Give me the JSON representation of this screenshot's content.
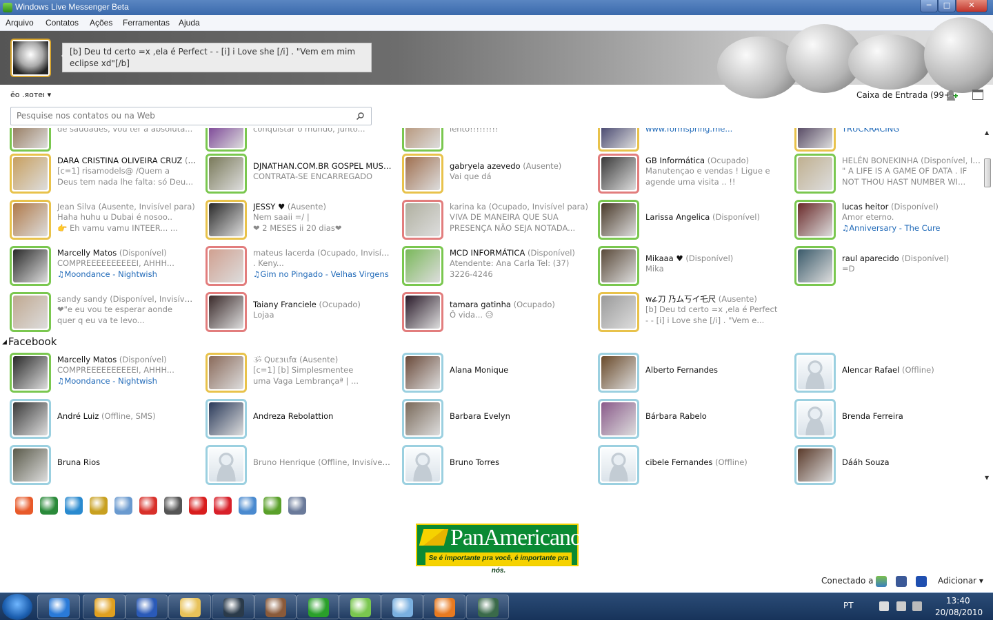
{
  "window": {
    "title": "Windows Live Messenger Beta",
    "minimize": "─",
    "maximize": "□",
    "close": "✕"
  },
  "menu": [
    "Arquivo",
    "Contatos",
    "Ações",
    "Ferramentas",
    "Ajuda"
  ],
  "profile": {
    "status_message": "[b]    Deu td certo =x ,ela é Perfect  -   - [i] i Love she [/i] .    \"Vem em mim eclipse xd\"[/b]",
    "display_name": "ĕo .яoтeı ▾"
  },
  "inbox_label": "Caixa de Entrada (99+)",
  "search": {
    "placeholder": "Pesquise nos contatos ou na Web"
  },
  "contacts": [
    {
      "name": "",
      "status": "",
      "message": "de saudades, vou ter a absoluta...",
      "music": "",
      "state": "avail",
      "color": "#8a6a4a"
    },
    {
      "name": "",
      "status": "",
      "message": "conquistar o mundo, junto...",
      "music": "",
      "state": "avail",
      "color": "#6a2a8a"
    },
    {
      "name": "",
      "status": "",
      "message": "lento!!!!!!!!!",
      "music": "",
      "state": "avail",
      "color": "#b08a6a"
    },
    {
      "name": "",
      "status": "",
      "message": "www.formspring.me...",
      "music": "",
      "state": "away",
      "color": "#2a2a5a",
      "link": true
    },
    {
      "name": "",
      "status": "",
      "message": "TRUCKRACING",
      "music": "",
      "state": "away",
      "color": "#3a2a4a",
      "link": true
    },
    {
      "name": "DARA CRISTINA OLIVEIRA CRUZ",
      "status": "(A...",
      "message": "[c=1] risamodels@ /Quem a",
      "message2": "Deus tem nada lhe falta: só Deu...",
      "music": "",
      "state": "away",
      "color": "#c8a060"
    },
    {
      "name": "DJNATHAN.COM.BR GOSPEL MUSIC",
      "status": "(",
      "message": "CONTRATA-SE ENCARREGADO",
      "music": "",
      "state": "avail",
      "color": "#7a7a5a"
    },
    {
      "name": "gabryela azevedo",
      "status": "(Ausente)",
      "message": "Vai que dá",
      "music": "",
      "state": "away",
      "color": "#a07050"
    },
    {
      "name": "GB Informática",
      "status": "(Ocupado)",
      "message": "Manutençao e vendas !  Ligue e",
      "message2": "agende uma visita .. !!",
      "music": "",
      "state": "busy",
      "color": "#3a3a3a"
    },
    {
      "name": "HELÉN BONEKINHA",
      "status": "(Disponível, Invi...",
      "message": "\"  A LIFE IS A GAME OF DATA . IF",
      "message2": "NOT THOU HAST NUMBER WI...",
      "music": "",
      "state": "avail",
      "color": "#c0b090",
      "dim": true
    },
    {
      "name": "Jean Silva",
      "status": "(Ausente, Invisível para)",
      "message": "Haha huhu u Dubai é nosoo..",
      "message2": "👉     Eh vamu vamu INTEER... ...",
      "music": "",
      "state": "away",
      "color": "#b07a4a",
      "dim": true
    },
    {
      "name": "JESSY ♥",
      "status": "(Ausente)",
      "message": "Nem saaii =/                        |",
      "message2": "❤ 2 MESES ii 20 dias❤",
      "music": "",
      "state": "away",
      "color": "#2a2a2a"
    },
    {
      "name": "karina ka",
      "status": "(Ocupado, Invisível para)",
      "message": "VIVA DE MANEIRA QUE SUA",
      "message2": "PRESENÇA NÃO SEJA NOTADA...",
      "music": "",
      "state": "busy",
      "color": "#b0b0a0",
      "dim": true
    },
    {
      "name": "Larissa Angelica",
      "status": "(Disponível)",
      "message": "",
      "music": "",
      "state": "avail",
      "color": "#4a3a2a"
    },
    {
      "name": "lucas heitor",
      "status": "(Disponível)",
      "message": "Amor eterno.",
      "music": "Anniversary - The Cure",
      "state": "avail",
      "color": "#6a2a2a"
    },
    {
      "name": "Marcelly Matos",
      "status": "(Disponível)",
      "message": "COMPREEEEEEEEEEI,   AHHH...",
      "music": "Moondance - Nightwish",
      "state": "avail",
      "color": "#2a2a2a"
    },
    {
      "name": "mateus lacerda",
      "status": "(Ocupado, Invisível ...",
      "message": ".                                    Keny...",
      "music": "Gim no Pingado - Velhas Virgens",
      "state": "busy",
      "color": "#d0a090",
      "dim": true
    },
    {
      "name": "MCD INFORMÁTICA",
      "status": "(Disponível)",
      "message": "Atendente: Ana Carla Tel: (37)",
      "message2": "3226-4246",
      "music": "",
      "state": "avail",
      "color": "#7ab85a"
    },
    {
      "name": "Mikaaa ♥",
      "status": "(Disponível)",
      "message": "Mika",
      "music": "",
      "state": "avail",
      "color": "#5a4a3a"
    },
    {
      "name": "raul aparecido",
      "status": "(Disponível)",
      "message": "=D",
      "music": "",
      "state": "avail",
      "color": "#3a5a6a"
    },
    {
      "name": "sandy sandy",
      "status": "(Disponível, Invisível pa...",
      "message": "❤\"e eu vou te esperar aonde",
      "message2": "quer q eu va te levo...",
      "music": "",
      "state": "avail",
      "color": "#c0a890",
      "dim": true
    },
    {
      "name": "Taiany Franciele",
      "status": "(Ocupado)",
      "message": "Lojaa",
      "music": "",
      "state": "busy",
      "color": "#3a2a2a"
    },
    {
      "name": "tamara gatinha",
      "status": "(Ocupado)",
      "message": "Ô vida... 😥",
      "music": "",
      "state": "busy",
      "color": "#2a1a2a"
    },
    {
      "name": "wፊ刀  乃ム丂イ乇尺",
      "status": "(Ausente)",
      "message": "[b]   Deu td certo =x ,ela é Perfect",
      "message2": "-   - [i] i Love she [/i] .   \"Vem e...",
      "music": "",
      "state": "away",
      "color": "#9a9a9a"
    }
  ],
  "facebook_group": {
    "label": "Facebook"
  },
  "facebook_contacts": [
    {
      "name": "Marcelly Matos",
      "status": "(Disponível)",
      "message": "COMPREEEEEEEEEEI,   AHHH...",
      "music": "Moondance - Nightwish",
      "state": "avail",
      "color": "#2a2a2a"
    },
    {
      "name": "ૐ Qυεзιιfα",
      "status": "(Ausente)",
      "message": "[c=1]   [b]   Simplesmentee",
      "message2": "uma Vaga Lembrançaª  |    ...",
      "music": "",
      "state": "away",
      "color": "#8a6a5a",
      "dim": true
    },
    {
      "name": "Alana Monique",
      "status": "",
      "message": "",
      "music": "",
      "state": "off",
      "color": "#6a4a3a"
    },
    {
      "name": "Alberto Fernandes",
      "status": "",
      "message": "",
      "music": "",
      "state": "off",
      "color": "#6a4a2a"
    },
    {
      "name": "Alencar Rafael",
      "status": "(Offline)",
      "message": "",
      "music": "",
      "state": "off",
      "color": "",
      "placeholder": true
    },
    {
      "name": "André Luiz",
      "status": "(Offline, SMS)",
      "message": "",
      "music": "",
      "state": "off",
      "color": "#3a3a3a"
    },
    {
      "name": "Andreza Rebolattion",
      "status": "",
      "message": "",
      "music": "",
      "state": "off",
      "color": "#2a3a5a"
    },
    {
      "name": "Barbara Evelyn",
      "status": "",
      "message": "",
      "music": "",
      "state": "off",
      "color": "#7a6a5a"
    },
    {
      "name": "Bárbara Rabelo",
      "status": "",
      "message": "",
      "music": "",
      "state": "off",
      "color": "#8a5a8a"
    },
    {
      "name": "Brenda Ferreira",
      "status": "",
      "message": "",
      "music": "",
      "state": "off",
      "color": "",
      "placeholder": true
    },
    {
      "name": "Bruna Rios",
      "status": "",
      "message": "",
      "music": "",
      "state": "off",
      "color": "#5a5a4a"
    },
    {
      "name": "Bruno Henrique",
      "status": "(Offline, Invisível pa...",
      "message": "",
      "music": "",
      "state": "off",
      "color": "",
      "placeholder": true,
      "dim": true
    },
    {
      "name": "Bruno Torres",
      "status": "",
      "message": "",
      "music": "",
      "state": "off",
      "color": "",
      "placeholder": true
    },
    {
      "name": "cibele Fernandes",
      "status": "(Offline)",
      "message": "",
      "music": "",
      "state": "off",
      "color": "",
      "placeholder": true
    },
    {
      "name": "Dááh Souza",
      "status": "",
      "message": "",
      "music": "",
      "state": "off",
      "color": "#5a3a2a"
    }
  ],
  "app_bar": [
    "msn-butterfly-icon",
    "ak-icon",
    "messenger-swirl-icon",
    "game-icon",
    "guitar-icon",
    "stripes-icon",
    "face-icon",
    "claro-icon",
    "heart-icon",
    "people-icon",
    "frog-icon",
    "camera-icon"
  ],
  "ad": {
    "brand": "PanAmericano",
    "tagline": "Se é importante pra você, é importante pra nós."
  },
  "footer": {
    "connected_label": "Conectado a",
    "add_label": "Adicionar ▾"
  },
  "tray": {
    "language": "PT",
    "time": "13:40",
    "date": "20/08/2010"
  },
  "colors": {
    "available": "#7ac74f",
    "busy": "#e27d7d",
    "away": "#e8c24b",
    "offline": "#9bd0e0",
    "music": "#1f69b8"
  }
}
